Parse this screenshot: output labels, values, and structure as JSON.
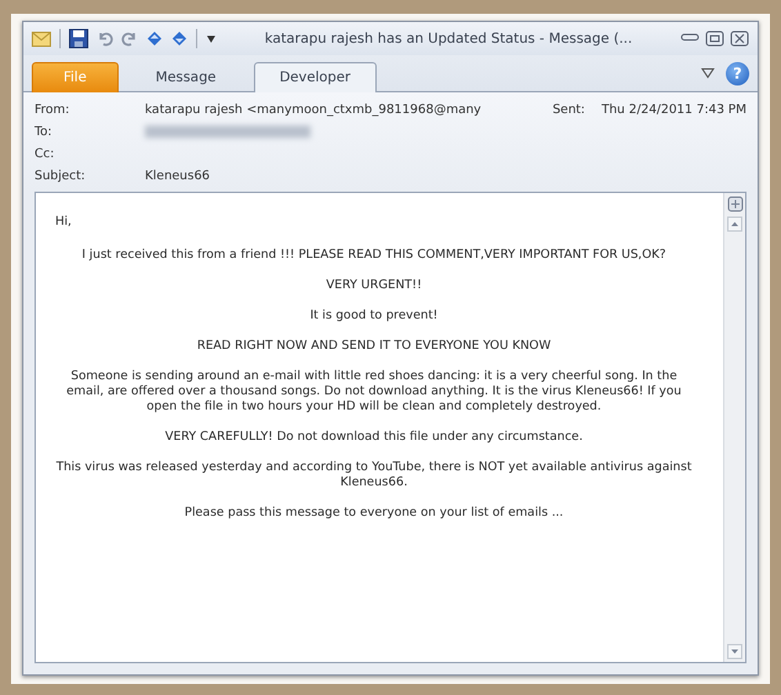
{
  "window": {
    "title": "katarapu rajesh has an Updated Status - Message (...",
    "help": "?"
  },
  "tabs": [
    {
      "label": "File",
      "kind": "backstage",
      "selected": false
    },
    {
      "label": "Message",
      "kind": "ribbon",
      "selected": false
    },
    {
      "label": "Developer",
      "kind": "ribbon",
      "selected": true
    }
  ],
  "header": [
    {
      "label": "From:",
      "value": "katarapu rajesh <manymoon_ctxmb_9811968@many",
      "kind": "text"
    },
    {
      "label": "To:",
      "kind": "redacted"
    },
    {
      "label": "Cc:",
      "kind": "empty"
    },
    {
      "label": "Subject:",
      "value": "Kleneus66",
      "kind": "text"
    }
  ],
  "sent": {
    "label": "Sent:",
    "value": "Thu 2/24/2011 7:43 PM"
  },
  "body": [
    {
      "kind": "greeting",
      "text": "Hi,"
    },
    {
      "kind": "centered",
      "text": "I just received this from a friend !!! PLEASE READ THIS COMMENT,VERY IMPORTANT FOR US,OK?"
    },
    {
      "kind": "centered",
      "text": "VERY URGENT!!"
    },
    {
      "kind": "centered",
      "text": "It is good to prevent!"
    },
    {
      "kind": "centered",
      "text": "READ RIGHT NOW AND SEND IT TO EVERYONE YOU KNOW"
    },
    {
      "kind": "centered",
      "text": "Someone is sending around an e-mail with little red shoes dancing: it is a very cheerful song. In the email, are offered over a thousand songs. Do not download anything. It is the virus Kleneus66! If you open the file in two hours your HD will be clean and completely destroyed."
    },
    {
      "kind": "centered",
      "text": "VERY CAREFULLY! Do not download this file under any circumstance."
    },
    {
      "kind": "centered",
      "text": "This virus was released yesterday and according to YouTube, there is NOT yet available antivirus against Kleneus66."
    },
    {
      "kind": "centered",
      "text": "Please pass this message to everyone on your list of emails ..."
    }
  ]
}
